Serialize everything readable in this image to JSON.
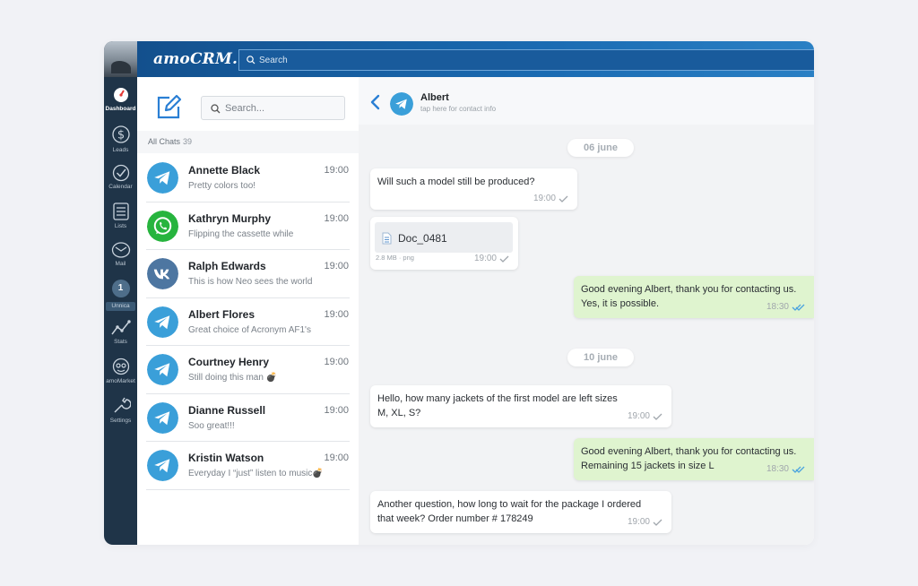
{
  "app": {
    "logo": "amoCRM."
  },
  "topbar": {
    "search_placeholder": "Search"
  },
  "rail": {
    "items": [
      {
        "label": "Dashboard",
        "icon": "dashboard-icon"
      },
      {
        "label": "Leads",
        "icon": "dollar-icon"
      },
      {
        "label": "Calendar",
        "icon": "check-circle-icon"
      },
      {
        "label": "Lists",
        "icon": "lists-icon"
      },
      {
        "label": "Mail",
        "icon": "mail-icon"
      },
      {
        "label": "Stats",
        "icon": "stats-icon"
      },
      {
        "label": "amoMarket",
        "icon": "market-icon"
      },
      {
        "label": "Settings",
        "icon": "wrench-icon"
      }
    ],
    "badge": {
      "value": "1",
      "label": "Unnica"
    }
  },
  "chatlist": {
    "search_placeholder": "Search...",
    "all_chats_label": "All Chats",
    "all_chats_count": "39",
    "chats": [
      {
        "name": "Annette Black",
        "time": "19:00",
        "preview": "Pretty colors too!",
        "channel": "telegram"
      },
      {
        "name": "Kathryn Murphy",
        "time": "19:00",
        "preview": "Flipping the cassette while",
        "channel": "whatsapp"
      },
      {
        "name": "Ralph Edwards",
        "time": "19:00",
        "preview": "This is how Neo sees the world",
        "channel": "vk"
      },
      {
        "name": "Albert Flores",
        "time": "19:00",
        "preview": "Great choice of Acronym AF1's",
        "channel": "telegram"
      },
      {
        "name": "Courtney Henry",
        "time": "19:00",
        "preview": "Still doing this man 💣",
        "channel": "telegram"
      },
      {
        "name": "Dianne Russell",
        "time": "19:00",
        "preview": "Soo great!!!",
        "channel": "telegram"
      },
      {
        "name": "Kristin Watson",
        "time": "19:00",
        "preview": "Everyday I “just” listen to music💣",
        "channel": "telegram"
      }
    ]
  },
  "conversation": {
    "contact_name": "Albert",
    "contact_sub": "tap here for contact info",
    "dates": [
      "06 june",
      "10 june"
    ],
    "messages": [
      {
        "dir": "in",
        "text": "Will such a model still be produced?",
        "time": "19:00"
      },
      {
        "dir": "in",
        "file_name": "Doc_0481",
        "file_info": "2.8 MB · png",
        "time": "19:00"
      },
      {
        "dir": "out",
        "text": "Good evening Albert, thank you for contacting us. Yes, it is possible.",
        "time": "18:30"
      },
      {
        "dir": "in",
        "text": "Hello, how many jackets of the first model are left sizes M, XL, S?",
        "time": "19:00"
      },
      {
        "dir": "out",
        "text": "Good evening Albert, thank you for contacting us. Remaining 15 jackets in size L",
        "time": "18:30"
      },
      {
        "dir": "in",
        "text": "Another question, how long to wait for the package I ordered that week? Order number # 178249",
        "time": "19:00"
      }
    ]
  },
  "colors": {
    "telegram": "#3a9fd9",
    "whatsapp": "#27b43e",
    "vk": "#4d76a1",
    "outgoing_bubble": "#dff4cf",
    "accent": "#1a6bb2"
  }
}
